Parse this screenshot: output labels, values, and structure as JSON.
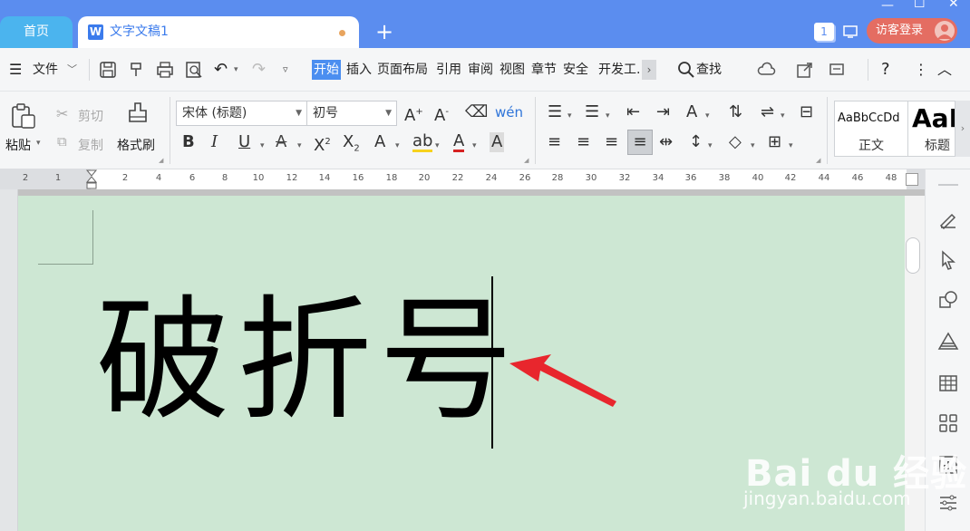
{
  "titlebar": {
    "home_tab": "首页",
    "doc_tab": "文字文稿1",
    "add_tab": "+",
    "badge": "1",
    "login": "访客登录"
  },
  "menu": {
    "file": "文件",
    "tabs": [
      "开始",
      "插入",
      "页面布局",
      "引用",
      "审阅",
      "视图",
      "章节",
      "安全",
      "开发工."
    ],
    "find": "查找"
  },
  "ribbon": {
    "paste": "粘贴",
    "cut": "剪切",
    "copy": "复制",
    "format_painter": "格式刷",
    "font_name": "宋体 (标题)",
    "font_size": "初号",
    "styles": [
      {
        "preview": "AaBbCcDd",
        "name": "正文"
      },
      {
        "preview": "AaI",
        "name": "标题"
      }
    ]
  },
  "ruler": {
    "ticks": [
      "2",
      "1",
      "2",
      "4",
      "6",
      "8",
      "10",
      "12",
      "14",
      "16",
      "18",
      "20",
      "22",
      "24",
      "26",
      "28",
      "30",
      "32",
      "34",
      "36",
      "38",
      "40",
      "42",
      "44",
      "46",
      "48"
    ]
  },
  "document": {
    "text": "破折号"
  },
  "watermark": {
    "logo": "Bai du 经验",
    "url": "jingyan.baidu.com"
  },
  "colors": {
    "titlebar": "#5b8def",
    "page": "#cde7d3",
    "active_tab": "#4b8ef0",
    "arrow": "#e8262d"
  }
}
